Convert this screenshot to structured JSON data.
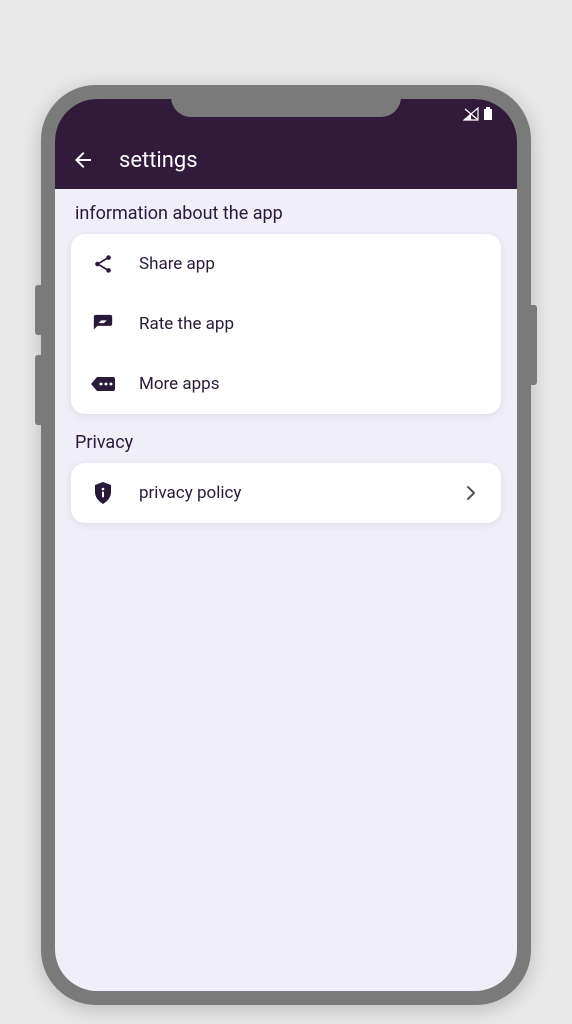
{
  "header": {
    "title": "settings"
  },
  "sections": {
    "info": {
      "label": "information about the app",
      "items": {
        "share": {
          "label": "Share app"
        },
        "rate": {
          "label": "Rate the app"
        },
        "more": {
          "label": "More apps"
        }
      }
    },
    "privacy": {
      "label": "Privacy",
      "items": {
        "policy": {
          "label": "privacy policy"
        }
      }
    }
  }
}
